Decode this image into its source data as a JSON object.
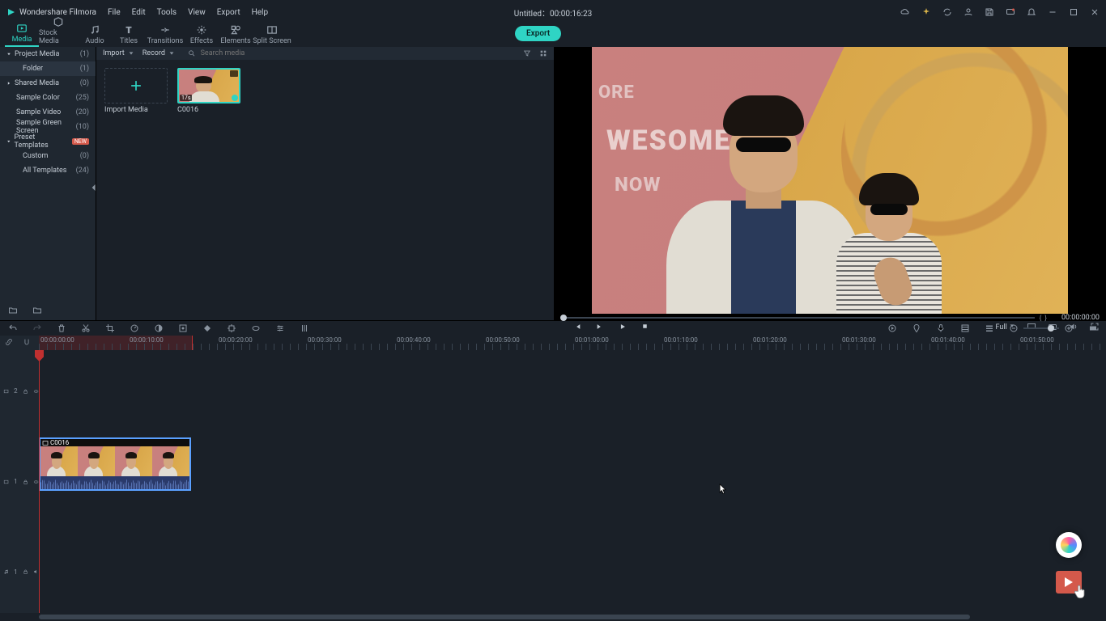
{
  "app": {
    "name": "Wondershare Filmora",
    "title_center": "Untitled：00:00:16:23"
  },
  "menus": [
    "File",
    "Edit",
    "Tools",
    "View",
    "Export",
    "Help"
  ],
  "tabs": [
    {
      "id": "media",
      "label": "Media",
      "icon": "media-icon",
      "active": true
    },
    {
      "id": "stock",
      "label": "Stock Media",
      "icon": "stock-icon",
      "active": false
    },
    {
      "id": "audio",
      "label": "Audio",
      "icon": "audio-icon",
      "active": false
    },
    {
      "id": "titles",
      "label": "Titles",
      "icon": "titles-icon",
      "active": false
    },
    {
      "id": "transitions",
      "label": "Transitions",
      "icon": "transitions-icon",
      "active": false
    },
    {
      "id": "effects",
      "label": "Effects",
      "icon": "effects-icon",
      "active": false
    },
    {
      "id": "elements",
      "label": "Elements",
      "icon": "elements-icon",
      "active": false
    },
    {
      "id": "split",
      "label": "Split Screen",
      "icon": "split-icon",
      "active": false
    }
  ],
  "export_label": "Export",
  "sidebar": {
    "items": [
      {
        "label": "Project Media",
        "count": "(1)",
        "expanded": true,
        "level": 0
      },
      {
        "label": "Folder",
        "count": "(1)",
        "active": true,
        "level": 1
      },
      {
        "label": "Shared Media",
        "count": "(0)",
        "expanded": false,
        "level": 0
      },
      {
        "label": "Sample Color",
        "count": "(25)",
        "level": 1
      },
      {
        "label": "Sample Video",
        "count": "(20)",
        "level": 1
      },
      {
        "label": "Sample Green Screen",
        "count": "(10)",
        "level": 1
      },
      {
        "label": "Preset Templates",
        "count": "",
        "new": true,
        "expanded": true,
        "level": 0
      },
      {
        "label": "Custom",
        "count": "(0)",
        "level": 1
      },
      {
        "label": "All Templates",
        "count": "(24)",
        "level": 1
      }
    ],
    "new_badge": "NEW"
  },
  "mediabar": {
    "import": "Import",
    "record": "Record",
    "search_placeholder": "Search media"
  },
  "media": {
    "import_tile_label": "Import Media",
    "clip_name": "C0016",
    "clip_duration_badge": "17s"
  },
  "preview": {
    "wall_text_1": "ORE",
    "wall_text_2": "WESOME",
    "wall_text_3": "NOW",
    "brackets": "{      }",
    "timecode": "00:00:00:00",
    "quality": "Full"
  },
  "timeline": {
    "ruler": [
      "00:00:00:00",
      "00:00:10:00",
      "00:00:20:00",
      "00:00:30:00",
      "00:00:40:00",
      "00:00:50:00",
      "00:01:00:00",
      "00:01:10:00",
      "00:01:20:00",
      "00:01:30:00",
      "00:01:40:00",
      "00:01:50:00"
    ],
    "tracks": {
      "v2": "2",
      "v1": "1",
      "a1": "1"
    },
    "clip": {
      "name": "C0016"
    }
  }
}
